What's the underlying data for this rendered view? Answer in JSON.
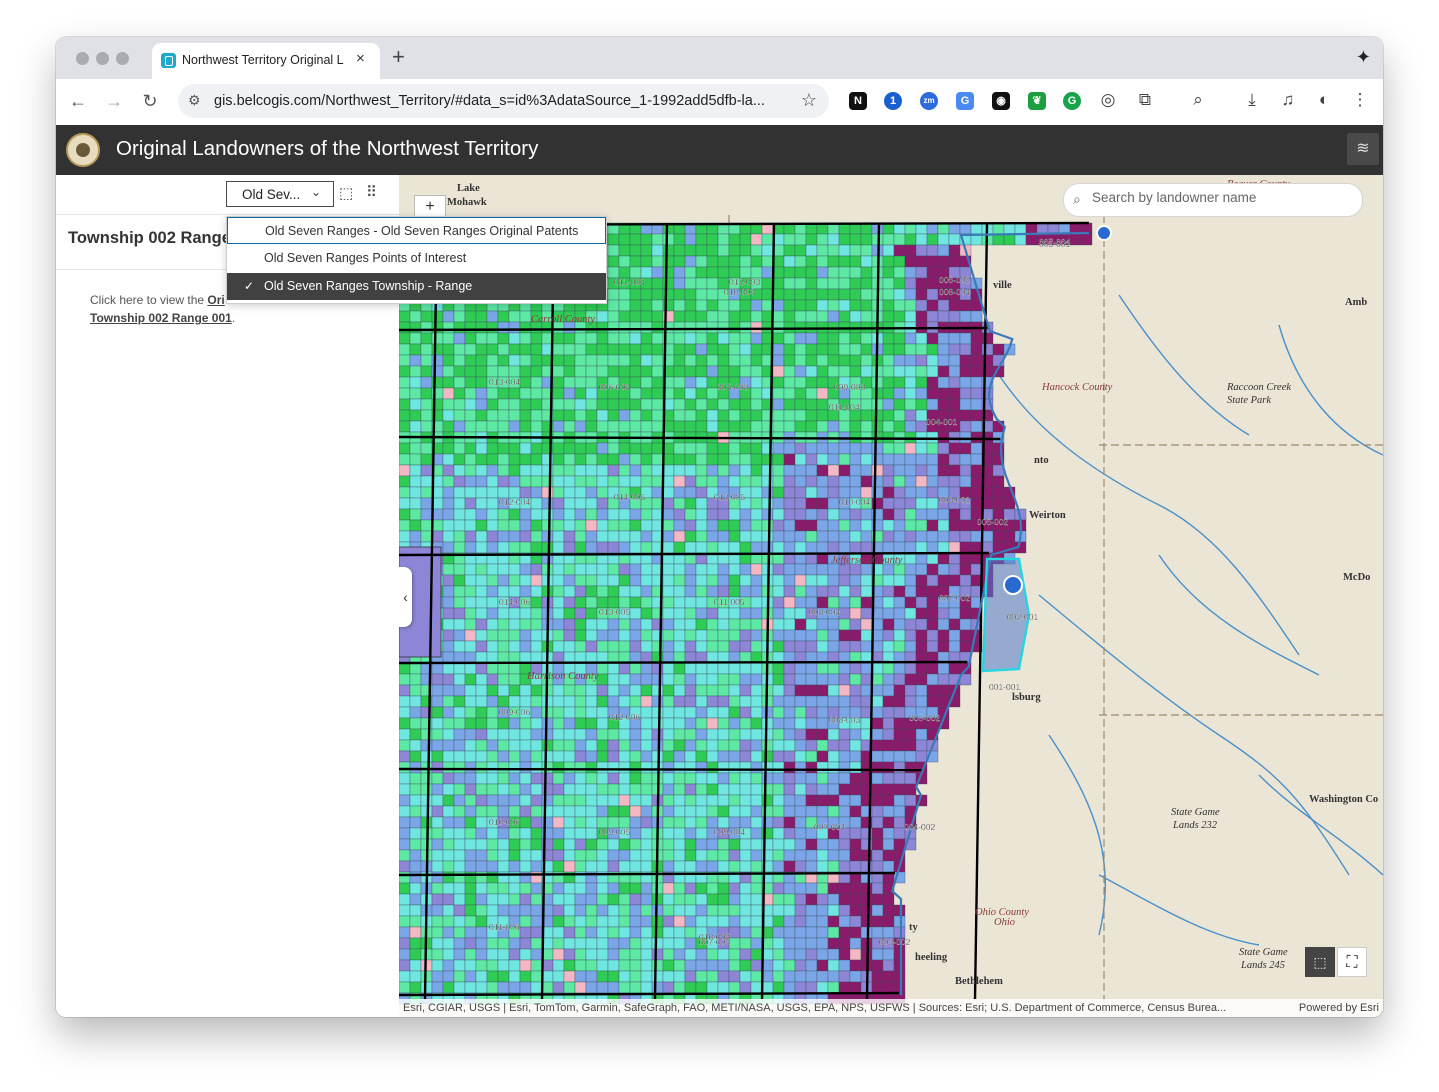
{
  "browser": {
    "tab_title": "Northwest Territory Original L",
    "tab_close": "×",
    "new_tab": "+",
    "url": "gis.belcogis.com/Northwest_Territory/#data_s=id%3AdataSource_1-1992add5dfb-la..."
  },
  "app": {
    "title": "Original Landowners of the Northwest Territory"
  },
  "side_panel": {
    "layer_select_value": "Old Sev...",
    "title": "Township 002 Range",
    "text_prefix": "Click here to view the ",
    "text_link_visible": "Ori",
    "text_link_line2": "Township 002 Range 001",
    "text_suffix": "."
  },
  "layer_dropdown": {
    "options": [
      {
        "label": "Old Seven Ranges - Old Seven Ranges Original Patents",
        "selected": false
      },
      {
        "label": "Old Seven Ranges Points of Interest",
        "selected": false
      },
      {
        "label": "Old Seven Ranges Township - Range",
        "selected": true
      }
    ]
  },
  "map": {
    "search_placeholder": "Search by landowner name",
    "zoom_in": "+",
    "attribution": "Esri, CGIAR, USGS | Esri, TomTom, Garmin, SafeGraph, FAO, METI/NASA, USGS, EPA, NPS, USFWS | Sources: Esri; U.S. Department of Commerce, Census Burea...",
    "powered_by": "Powered by Esri",
    "place_labels": [
      "Lake",
      "Mohawk",
      "Beaver County",
      "Amb",
      "Hancock County",
      "Raccoon Creek",
      "State Park",
      "nto",
      "Weirton",
      "McDo",
      "Jefferson County",
      "Harrison County",
      "Carroll County",
      "lsburg",
      "State Game",
      "Lands 232",
      "Washington Co",
      "Ohio County",
      "Ohio",
      "State Game",
      "Lands 245",
      "ville",
      "Bethlehem",
      "heeling",
      "ty"
    ],
    "township_labels": [
      "005-001",
      "006-002",
      "004-001",
      "003-001",
      "007-002",
      "002-001",
      "006-002",
      "001-001",
      "005-002",
      "004-002",
      "003-002",
      "007-004",
      "008-003",
      "007-003",
      "009-004",
      "008-004",
      "010-005",
      "009-005",
      "011-006",
      "010-006",
      "009-006",
      "012-006",
      "011-005",
      "010-004",
      "011-004",
      "012-005",
      "013-005",
      "014-006",
      "012-004",
      "013-004",
      "012-003",
      "011-003",
      "010-003",
      "009-003",
      "008-004",
      "007-004",
      "006-003",
      "005-002",
      "014-005",
      "012-003"
    ],
    "colors": {
      "green_dark": "#2ecc55",
      "green_light": "#5de8a4",
      "cyan": "#6fe6e0",
      "blue": "#7aa6e8",
      "lavender": "#8d86d6",
      "purple": "#8a1a6a",
      "pink": "#f4b8c4",
      "highlight": "#27d4e0"
    }
  }
}
